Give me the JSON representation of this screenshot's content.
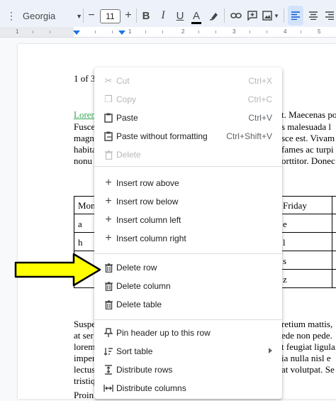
{
  "toolbar": {
    "font": "Georgia",
    "font_size": "11",
    "minus": "−",
    "plus": "+",
    "bold": "B",
    "italic": "I",
    "underline": "U",
    "text_color": "A"
  },
  "ruler": {
    "labels": [
      "1",
      "1",
      "2",
      "3",
      "4",
      "5",
      "6"
    ]
  },
  "document": {
    "page_counter": "1 of 3",
    "para1": [
      {
        "left": "Lorem",
        "right": "t. Maecenas po"
      },
      {
        "left": "Fusce",
        "right": "s malesuada l"
      },
      {
        "left": "magn",
        "right": "sce est. Vivam"
      },
      {
        "left": "habita",
        "right": "fames ac turpi"
      },
      {
        "left": "nonu",
        "right": "orttitor. Donec"
      }
    ],
    "table": {
      "left_col": [
        "Mon",
        "a",
        "h",
        "",
        ""
      ],
      "right_col": [
        "Friday",
        "e",
        "l",
        "s",
        "z"
      ]
    },
    "para2": [
      {
        "left": "Suspe",
        "right": "retium mattis,"
      },
      {
        "left": "at ser",
        "right": "ede non pede."
      },
      {
        "left": "lorem",
        "right": "t feugiat ligula."
      },
      {
        "left": "imper",
        "right": "ia nulla nisl e"
      },
      {
        "left": "lectus",
        "right": "at volutpat. Se"
      },
      {
        "left": "tristiq",
        "right": ""
      },
      {
        "left": "Proin",
        "right": ""
      }
    ]
  },
  "context_menu": {
    "items": [
      {
        "label": "Cut",
        "shortcut": "Ctrl+X",
        "icon": "scissors-icon",
        "disabled": true
      },
      {
        "label": "Copy",
        "shortcut": "Ctrl+C",
        "icon": "copy-icon",
        "disabled": true
      },
      {
        "label": "Paste",
        "shortcut": "Ctrl+V",
        "icon": "clipboard-icon",
        "disabled": false
      },
      {
        "label": "Paste without formatting",
        "shortcut": "Ctrl+Shift+V",
        "icon": "clipboard-plain-icon",
        "disabled": false
      },
      {
        "label": "Delete",
        "shortcut": "",
        "icon": "trash-icon",
        "disabled": true
      },
      {
        "label": "Insert row above",
        "icon": "plus-icon"
      },
      {
        "label": "Insert row below",
        "icon": "plus-icon"
      },
      {
        "label": "Insert column left",
        "icon": "plus-icon"
      },
      {
        "label": "Insert column right",
        "icon": "plus-icon"
      },
      {
        "label": "Delete row",
        "icon": "trash-icon"
      },
      {
        "label": "Delete column",
        "icon": "trash-icon"
      },
      {
        "label": "Delete table",
        "icon": "trash-icon"
      },
      {
        "label": "Pin header up to this row",
        "icon": "pin-icon"
      },
      {
        "label": "Sort table",
        "icon": "sort-icon",
        "has_submenu": true
      },
      {
        "label": "Distribute rows",
        "icon": "distribute-rows-icon"
      },
      {
        "label": "Distribute columns",
        "icon": "distribute-columns-icon"
      }
    ]
  },
  "annotation": {
    "arrow_color": "#ffff00",
    "arrow_outline": "#000000"
  }
}
